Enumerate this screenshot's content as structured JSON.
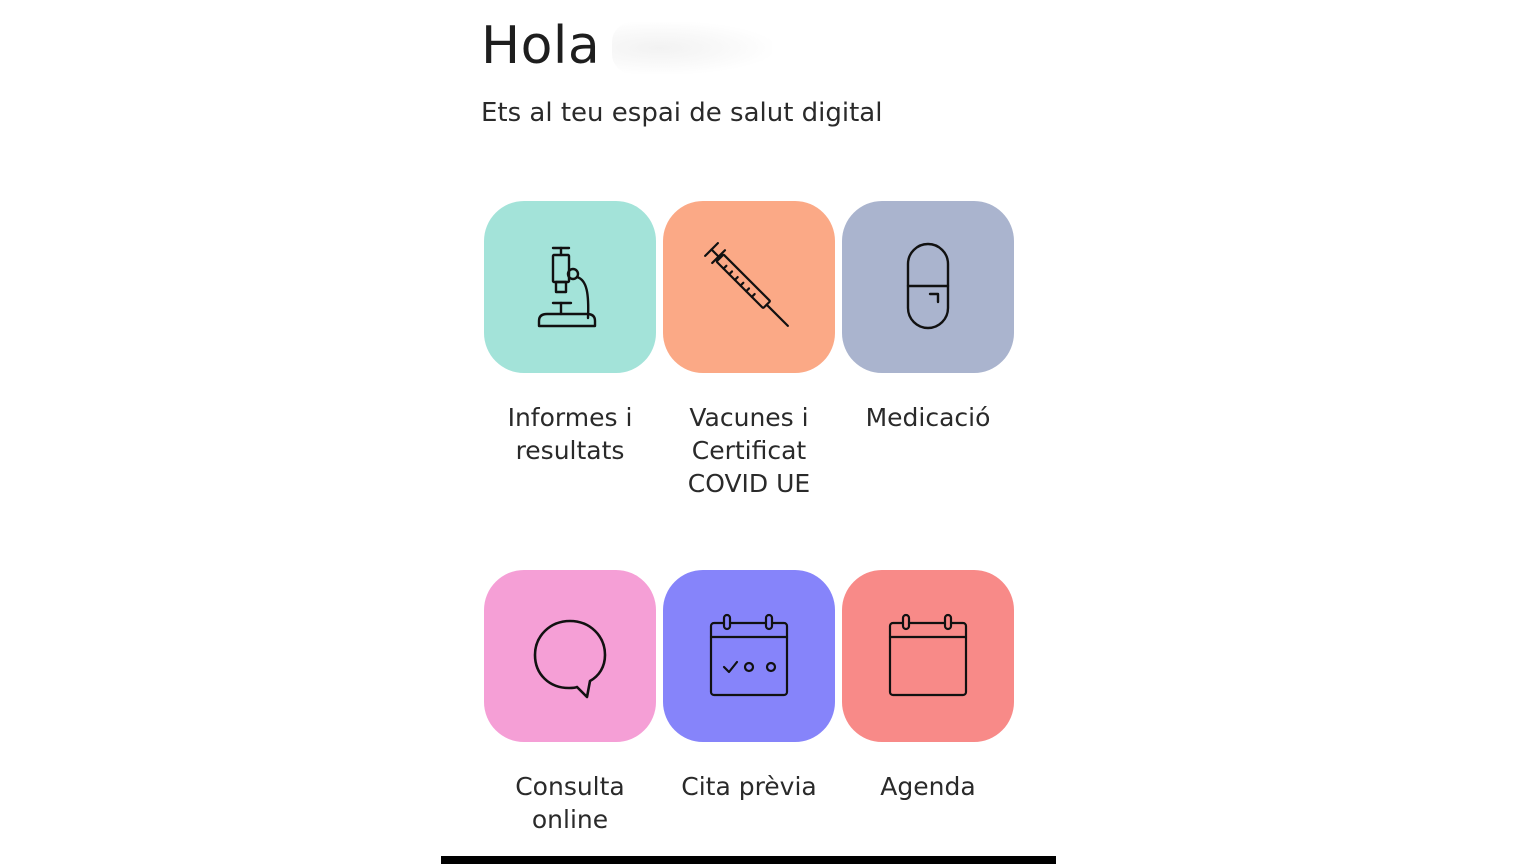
{
  "header": {
    "greeting": "Hola",
    "subtitle": "Ets al teu espai de salut digital"
  },
  "tiles": [
    {
      "label": "Informes i\nresultats",
      "color": "#a3e3d9",
      "icon": "microscope-icon"
    },
    {
      "label": "Vacunes i\nCertificat\nCOVID UE",
      "color": "#fba986",
      "icon": "syringe-icon"
    },
    {
      "label": "Medicació",
      "color": "#aab4ce",
      "icon": "pill-icon"
    },
    {
      "label": "Consulta\nonline",
      "color": "#f59fd6",
      "icon": "speech-bubble-icon"
    },
    {
      "label": "Cita prèvia",
      "color": "#8684fa",
      "icon": "calendar-check-icon"
    },
    {
      "label": "Agenda",
      "color": "#f88a88",
      "icon": "calendar-icon"
    }
  ]
}
